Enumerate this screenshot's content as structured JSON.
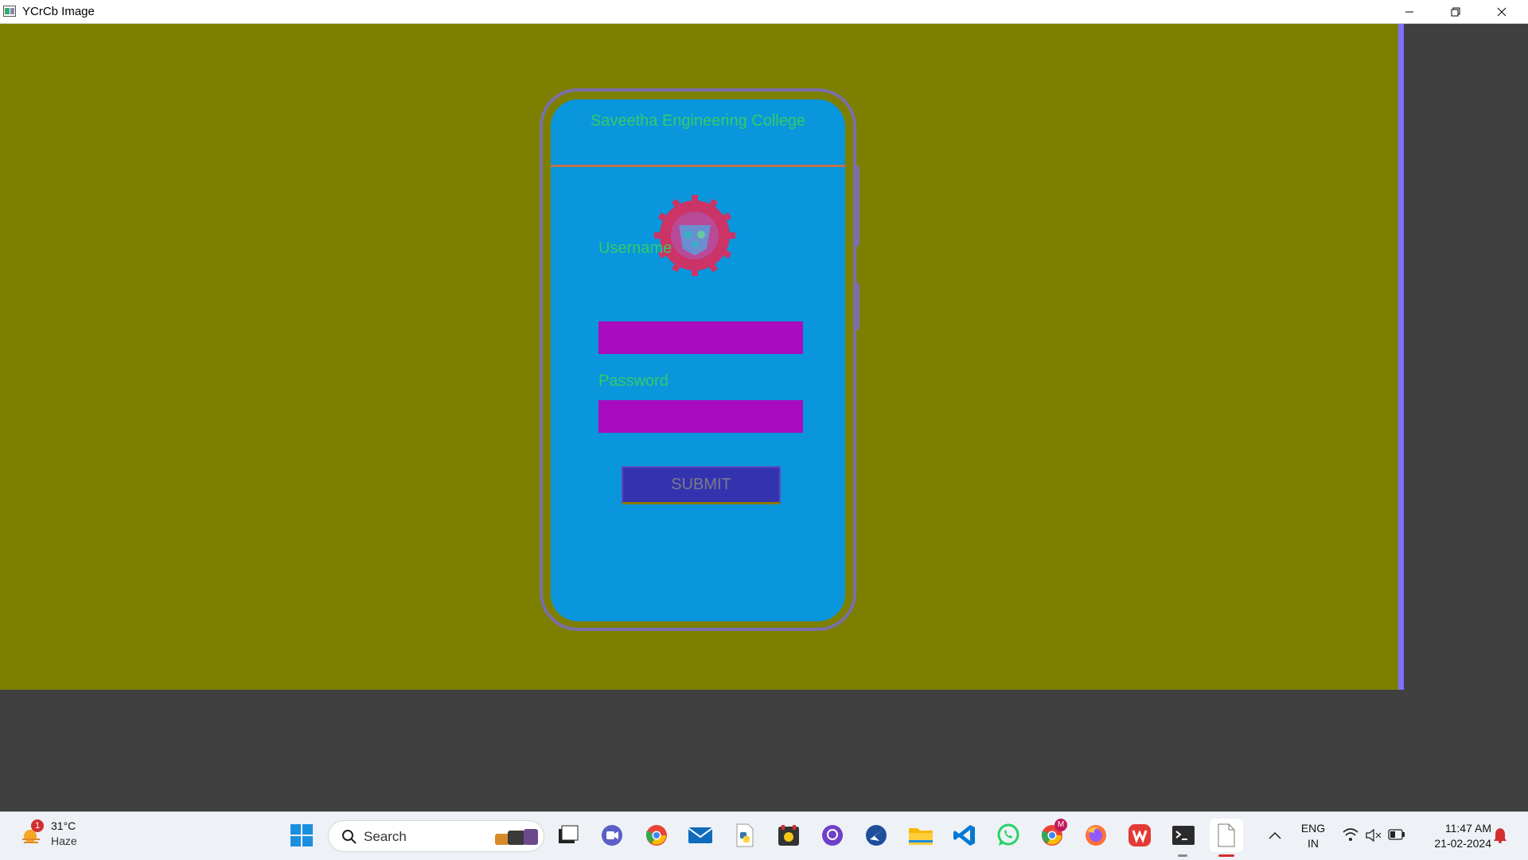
{
  "window": {
    "title": "YCrCb Image"
  },
  "colors": {
    "background": "#7d7f00",
    "screen": "#0a96dc",
    "header_text": "#33cc66",
    "field": "#a80cbe",
    "button": "#3333b0",
    "accent_strip": "#7c72ff"
  },
  "app": {
    "header": "Saveetha Engineering College",
    "username_label": "Username",
    "username_value": "",
    "password_label": "Password",
    "password_value": "",
    "submit_label": "SUBMIT"
  },
  "taskbar": {
    "weather": {
      "temp": "31°C",
      "condition": "Haze",
      "badge": "1"
    },
    "search_placeholder": "Search",
    "apps": [
      "start",
      "search",
      "task-view",
      "meet",
      "chrome",
      "mail",
      "python",
      "media",
      "github",
      "messenger",
      "file-explorer",
      "vscode",
      "whatsapp",
      "chrome-profile",
      "firefox",
      "wps-office",
      "terminal",
      "notepad"
    ],
    "chrome_profile_badge": "M",
    "language": {
      "line1": "ENG",
      "line2": "IN"
    },
    "clock": {
      "time": "11:47 AM",
      "date": "21-02-2024"
    }
  }
}
